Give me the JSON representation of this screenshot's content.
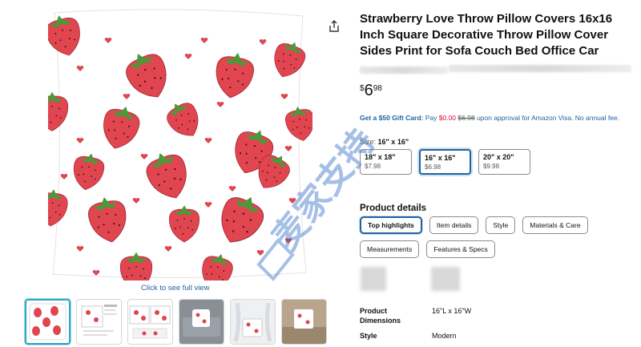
{
  "product": {
    "title": "Strawberry Love Throw Pillow Covers 16x16 Inch Square Decorative Throw Pillow Cover Sides Print for Sofa Couch Bed Office Car"
  },
  "gallery": {
    "see_full_label": "Click to see full view",
    "thumbnail_count": 6,
    "selected_index": 0
  },
  "price": {
    "currency": "$",
    "whole": "6",
    "fraction": "98"
  },
  "offer": {
    "lead": "Get a $50 Gift Card:",
    "pay_text": "Pay",
    "pay_value": "$0.00",
    "original": "$6.98",
    "rest": "upon approval for Amazon Visa. No annual fee."
  },
  "size": {
    "label": "Size:",
    "selected": "16\" x 16\"",
    "options": [
      {
        "name": "18\" x 18\"",
        "price": "$7.98"
      },
      {
        "name": "16\" x 16\"",
        "price": "$6.98"
      },
      {
        "name": "20\" x 20\"",
        "price": "$9.98"
      }
    ]
  },
  "details": {
    "heading": "Product details",
    "chips": [
      "Top highlights",
      "Item details",
      "Style",
      "Materials & Care",
      "Measurements",
      "Features & Specs"
    ],
    "specs": [
      {
        "label": "Product Dimensions",
        "value": "16\"L x 16\"W"
      },
      {
        "label": "Style",
        "value": "Modern"
      }
    ]
  },
  "watermark": {
    "text": "麦家支持"
  },
  "colors": {
    "link": "#2162a1",
    "selected_border": "#2162a1",
    "price_red": "#cc0c39",
    "strawberry": "#e04550",
    "leaf": "#4a9a3a"
  }
}
